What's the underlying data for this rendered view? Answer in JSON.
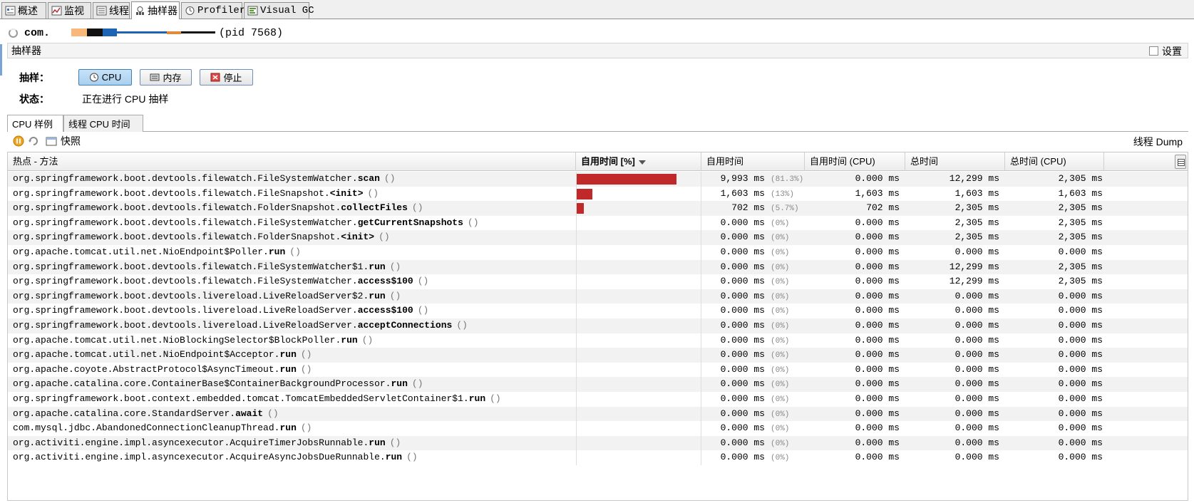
{
  "tabs": [
    {
      "label": "概述",
      "icon": "overview-icon"
    },
    {
      "label": "监视",
      "icon": "monitor-icon"
    },
    {
      "label": "线程",
      "icon": "threads-icon"
    },
    {
      "label": "抽样器",
      "icon": "sampler-icon",
      "active": true
    },
    {
      "label": "Profiler",
      "icon": "profiler-icon"
    },
    {
      "label": "Visual GC",
      "icon": "visual-gc-icon"
    }
  ],
  "app": {
    "name": "com.",
    "pid": "(pid 7568)"
  },
  "sampler": {
    "title": "抽样器",
    "settings_label": "设置"
  },
  "sample": {
    "label": "抽样：",
    "cpu_label": "CPU",
    "memory_label": "内存",
    "stop_label": "停止"
  },
  "status": {
    "label": "状态：",
    "value": "正在进行 CPU 抽样"
  },
  "subtabs": {
    "cpu_samples": "CPU 样例",
    "thread_cpu_time": "线程 CPU 时间"
  },
  "toolbar": {
    "snapshot_label": "快照",
    "thread_dump": "线程 Dump"
  },
  "table": {
    "columns": [
      "热点 - 方法",
      "自用时间 [%]",
      "自用时间",
      "自用时间 (CPU)",
      "总时间",
      "总时间 (CPU)"
    ],
    "rows": [
      {
        "prefix": "org.springframework.boot.devtools.filewatch.FileSystemWatcher.",
        "name": "scan",
        "args": "()",
        "bar": 81.3,
        "self": "9,993 ms",
        "pct": "(81.3%)",
        "self_cpu": "0.000 ms",
        "total": "12,299 ms",
        "total_cpu": "2,305 ms"
      },
      {
        "prefix": "org.springframework.boot.devtools.filewatch.FileSnapshot.",
        "name": "<init>",
        "args": "()",
        "bar": 13,
        "self": "1,603 ms",
        "pct": "(13%)",
        "self_cpu": "1,603 ms",
        "total": "1,603 ms",
        "total_cpu": "1,603 ms"
      },
      {
        "prefix": "org.springframework.boot.devtools.filewatch.FolderSnapshot.",
        "name": "collectFiles",
        "args": "()",
        "bar": 5.7,
        "self": "702 ms",
        "pct": "(5.7%)",
        "self_cpu": "702 ms",
        "total": "2,305 ms",
        "total_cpu": "2,305 ms"
      },
      {
        "prefix": "org.springframework.boot.devtools.filewatch.FileSystemWatcher.",
        "name": "getCurrentSnapshots",
        "args": "()",
        "bar": 0,
        "self": "0.000 ms",
        "pct": "(0%)",
        "self_cpu": "0.000 ms",
        "total": "2,305 ms",
        "total_cpu": "2,305 ms"
      },
      {
        "prefix": "org.springframework.boot.devtools.filewatch.FolderSnapshot.",
        "name": "<init>",
        "args": "()",
        "bar": 0,
        "self": "0.000 ms",
        "pct": "(0%)",
        "self_cpu": "0.000 ms",
        "total": "2,305 ms",
        "total_cpu": "2,305 ms"
      },
      {
        "prefix": "org.apache.tomcat.util.net.NioEndpoint$Poller.",
        "name": "run",
        "args": "()",
        "bar": 0,
        "self": "0.000 ms",
        "pct": "(0%)",
        "self_cpu": "0.000 ms",
        "total": "0.000 ms",
        "total_cpu": "0.000 ms"
      },
      {
        "prefix": "org.springframework.boot.devtools.filewatch.FileSystemWatcher$1.",
        "name": "run",
        "args": "()",
        "bar": 0,
        "self": "0.000 ms",
        "pct": "(0%)",
        "self_cpu": "0.000 ms",
        "total": "12,299 ms",
        "total_cpu": "2,305 ms"
      },
      {
        "prefix": "org.springframework.boot.devtools.filewatch.FileSystemWatcher.",
        "name": "access$100",
        "args": "()",
        "bar": 0,
        "self": "0.000 ms",
        "pct": "(0%)",
        "self_cpu": "0.000 ms",
        "total": "12,299 ms",
        "total_cpu": "2,305 ms"
      },
      {
        "prefix": "org.springframework.boot.devtools.livereload.LiveReloadServer$2.",
        "name": "run",
        "args": "()",
        "bar": 0,
        "self": "0.000 ms",
        "pct": "(0%)",
        "self_cpu": "0.000 ms",
        "total": "0.000 ms",
        "total_cpu": "0.000 ms"
      },
      {
        "prefix": "org.springframework.boot.devtools.livereload.LiveReloadServer.",
        "name": "access$100",
        "args": "()",
        "bar": 0,
        "self": "0.000 ms",
        "pct": "(0%)",
        "self_cpu": "0.000 ms",
        "total": "0.000 ms",
        "total_cpu": "0.000 ms"
      },
      {
        "prefix": "org.springframework.boot.devtools.livereload.LiveReloadServer.",
        "name": "acceptConnections",
        "args": "()",
        "bar": 0,
        "self": "0.000 ms",
        "pct": "(0%)",
        "self_cpu": "0.000 ms",
        "total": "0.000 ms",
        "total_cpu": "0.000 ms"
      },
      {
        "prefix": "org.apache.tomcat.util.net.NioBlockingSelector$BlockPoller.",
        "name": "run",
        "args": "()",
        "bar": 0,
        "self": "0.000 ms",
        "pct": "(0%)",
        "self_cpu": "0.000 ms",
        "total": "0.000 ms",
        "total_cpu": "0.000 ms"
      },
      {
        "prefix": "org.apache.tomcat.util.net.NioEndpoint$Acceptor.",
        "name": "run",
        "args": "()",
        "bar": 0,
        "self": "0.000 ms",
        "pct": "(0%)",
        "self_cpu": "0.000 ms",
        "total": "0.000 ms",
        "total_cpu": "0.000 ms"
      },
      {
        "prefix": "org.apache.coyote.AbstractProtocol$AsyncTimeout.",
        "name": "run",
        "args": "()",
        "bar": 0,
        "self": "0.000 ms",
        "pct": "(0%)",
        "self_cpu": "0.000 ms",
        "total": "0.000 ms",
        "total_cpu": "0.000 ms"
      },
      {
        "prefix": "org.apache.catalina.core.ContainerBase$ContainerBackgroundProcessor.",
        "name": "run",
        "args": "()",
        "bar": 0,
        "self": "0.000 ms",
        "pct": "(0%)",
        "self_cpu": "0.000 ms",
        "total": "0.000 ms",
        "total_cpu": "0.000 ms"
      },
      {
        "prefix": "org.springframework.boot.context.embedded.tomcat.TomcatEmbeddedServletContainer$1.",
        "name": "run",
        "args": "()",
        "bar": 0,
        "self": "0.000 ms",
        "pct": "(0%)",
        "self_cpu": "0.000 ms",
        "total": "0.000 ms",
        "total_cpu": "0.000 ms"
      },
      {
        "prefix": "org.apache.catalina.core.StandardServer.",
        "name": "await",
        "args": "()",
        "bar": 0,
        "self": "0.000 ms",
        "pct": "(0%)",
        "self_cpu": "0.000 ms",
        "total": "0.000 ms",
        "total_cpu": "0.000 ms"
      },
      {
        "prefix": "com.mysql.jdbc.AbandonedConnectionCleanupThread.",
        "name": "run",
        "args": "()",
        "bar": 0,
        "self": "0.000 ms",
        "pct": "(0%)",
        "self_cpu": "0.000 ms",
        "total": "0.000 ms",
        "total_cpu": "0.000 ms"
      },
      {
        "prefix": "org.activiti.engine.impl.asyncexecutor.AcquireTimerJobsRunnable.",
        "name": "run",
        "args": "()",
        "bar": 0,
        "self": "0.000 ms",
        "pct": "(0%)",
        "self_cpu": "0.000 ms",
        "total": "0.000 ms",
        "total_cpu": "0.000 ms"
      },
      {
        "prefix": "org.activiti.engine.impl.asyncexecutor.AcquireAsyncJobsDueRunnable.",
        "name": "run",
        "args": "()",
        "bar": 0,
        "self": "0.000 ms",
        "pct": "(0%)",
        "self_cpu": "0.000 ms",
        "total": "0.000 ms",
        "total_cpu": "0.000 ms"
      }
    ]
  },
  "colors": {
    "bar": "#c0282a",
    "accent_blue": "#3c7fb1"
  }
}
